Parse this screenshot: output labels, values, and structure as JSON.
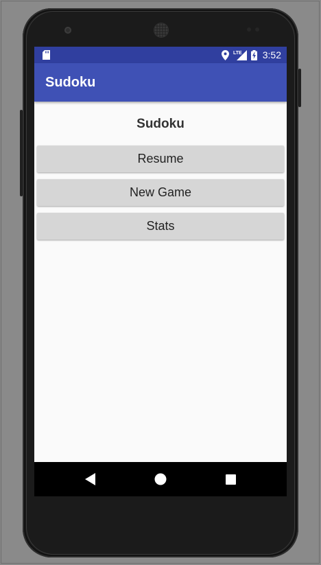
{
  "status_bar": {
    "time": "3:52",
    "network_label": "LTE",
    "icons": [
      "sd-card-icon",
      "location-pin-icon",
      "lte-signal-icon",
      "battery-charging-icon"
    ]
  },
  "app_bar": {
    "title": "Sudoku"
  },
  "main": {
    "title": "Sudoku",
    "buttons": [
      {
        "label": "Resume"
      },
      {
        "label": "New Game"
      },
      {
        "label": "Stats"
      }
    ]
  },
  "nav_bar": {
    "icons": [
      "back-icon",
      "home-icon",
      "recents-icon"
    ]
  },
  "colors": {
    "status_bar": "#303f9f",
    "app_bar": "#3f51b5",
    "button": "#d6d6d6",
    "background": "#fafafa"
  }
}
